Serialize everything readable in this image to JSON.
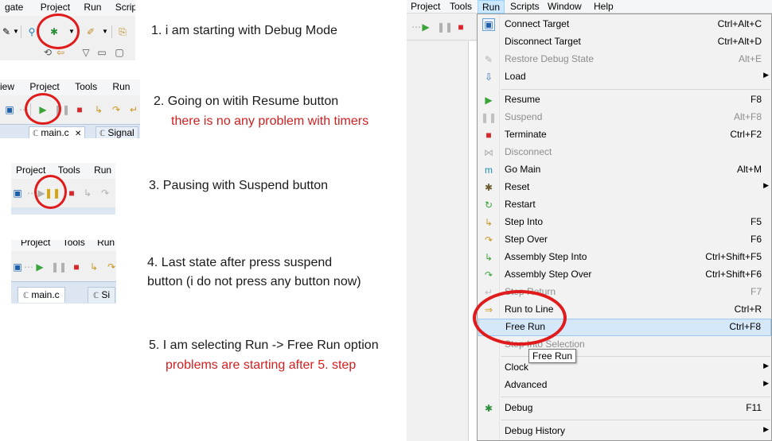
{
  "steps": [
    {
      "text": "1. i am starting with Debug Mode",
      "note": ""
    },
    {
      "text": "2. Going on witih Resume button",
      "note": "there is no any problem with timers"
    },
    {
      "text": "3. Pausing with Suspend button",
      "note": ""
    },
    {
      "text": "4. Last state after press suspend",
      "text2": "button (i do not press any button now)",
      "note": ""
    },
    {
      "text": "5. I am selecting Run -> Free Run option",
      "note": "problems are starting after 5. step"
    }
  ],
  "crop1": {
    "menus": [
      "gate",
      "Project",
      "Run",
      "Scripts"
    ]
  },
  "crop2": {
    "menus": [
      "iew",
      "Project",
      "Tools",
      "Run",
      "Sc"
    ],
    "tabs": [
      "main.c",
      "Signal"
    ]
  },
  "crop3": {
    "menus": [
      "Project",
      "Tools",
      "Run"
    ]
  },
  "crop4": {
    "menus": [
      "Project",
      "Tools",
      "Run"
    ],
    "tabs": [
      "main.c",
      "Si"
    ]
  },
  "menubar": {
    "items": [
      "Project",
      "Tools",
      "Run",
      "Scripts",
      "Window",
      "Help"
    ],
    "active": "Run"
  },
  "run_menu": {
    "items": [
      {
        "label": "Connect Target",
        "shortcut": "Ctrl+Alt+C",
        "icon": "connect-icon",
        "enabled": true
      },
      {
        "label": "Disconnect Target",
        "shortcut": "Ctrl+Alt+D",
        "icon": "",
        "enabled": true
      },
      {
        "label": "Restore Debug State",
        "shortcut": "Alt+E",
        "icon": "restore-icon",
        "enabled": false
      },
      {
        "label": "Load",
        "shortcut": "",
        "icon": "load-icon",
        "enabled": true,
        "submenu": true
      },
      {
        "label": "Resume",
        "shortcut": "F8",
        "icon": "resume-icon",
        "enabled": true
      },
      {
        "label": "Suspend",
        "shortcut": "Alt+F8",
        "icon": "suspend-icon",
        "enabled": false
      },
      {
        "label": "Terminate",
        "shortcut": "Ctrl+F2",
        "icon": "terminate-icon",
        "enabled": true
      },
      {
        "label": "Disconnect",
        "shortcut": "",
        "icon": "disconnect-icon",
        "enabled": false
      },
      {
        "label": "Go Main",
        "shortcut": "Alt+M",
        "icon": "go-main-icon",
        "enabled": true
      },
      {
        "label": "Reset",
        "shortcut": "",
        "icon": "reset-icon",
        "enabled": true,
        "submenu": true
      },
      {
        "label": "Restart",
        "shortcut": "",
        "icon": "restart-icon",
        "enabled": true
      },
      {
        "label": "Step Into",
        "shortcut": "F5",
        "icon": "step-into-icon",
        "enabled": true
      },
      {
        "label": "Step Over",
        "shortcut": "F6",
        "icon": "step-over-icon",
        "enabled": true
      },
      {
        "label": "Assembly Step Into",
        "shortcut": "Ctrl+Shift+F5",
        "icon": "asm-step-into-icon",
        "enabled": true
      },
      {
        "label": "Assembly Step Over",
        "shortcut": "Ctrl+Shift+F6",
        "icon": "asm-step-over-icon",
        "enabled": true
      },
      {
        "label": "Step Return",
        "shortcut": "F7",
        "icon": "step-return-icon",
        "enabled": false
      },
      {
        "label": "Run to Line",
        "shortcut": "Ctrl+R",
        "icon": "run-to-line-icon",
        "enabled": true
      },
      {
        "label": "Free Run",
        "shortcut": "Ctrl+F8",
        "icon": "",
        "enabled": true,
        "highlighted": true
      },
      {
        "label": "Step Into Selection",
        "shortcut": "",
        "icon": "",
        "enabled": false
      },
      {
        "label": "Clock",
        "shortcut": "",
        "icon": "",
        "enabled": true,
        "submenu": true
      },
      {
        "label": "Advanced",
        "shortcut": "",
        "icon": "",
        "enabled": true,
        "submenu": true
      },
      {
        "label": "Debug",
        "shortcut": "F11",
        "icon": "debug-icon",
        "enabled": true
      },
      {
        "label": "Debug History",
        "shortcut": "",
        "icon": "",
        "enabled": true,
        "submenu": true
      }
    ]
  },
  "tooltip": "Free Run",
  "colors": {
    "highlight": "#e01b1b",
    "note": "#d02020",
    "menu_hover": "#d5e8fa",
    "accent_green": "#3aa33a",
    "accent_red": "#d8262b"
  }
}
